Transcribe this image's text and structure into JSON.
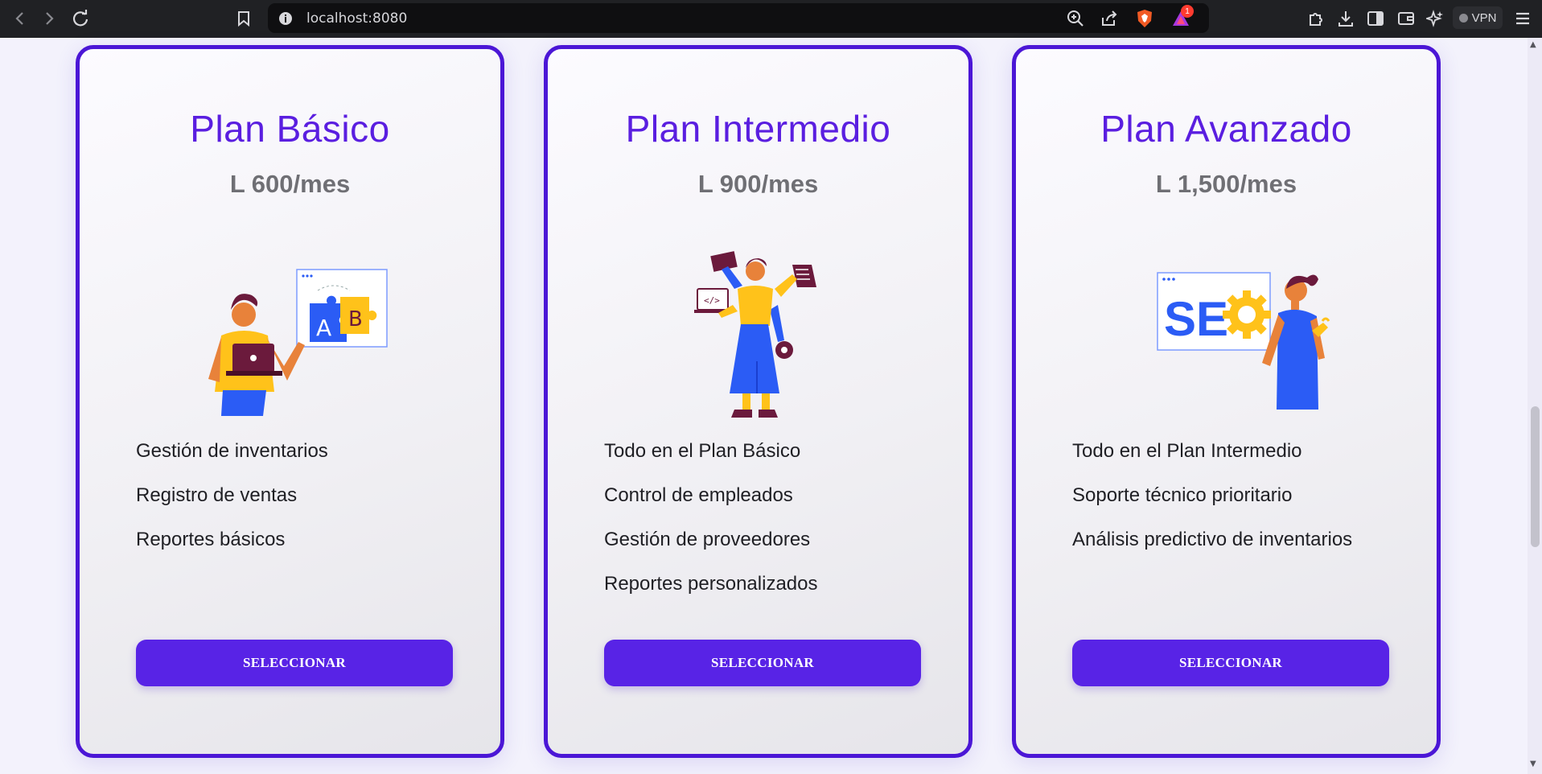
{
  "browser": {
    "url": "localhost:8080",
    "vpn_label": "VPN",
    "notification_count": "1"
  },
  "plans": [
    {
      "title": "Plan Básico",
      "price": "L 600/mes",
      "illustration": "ab-testing-illustration",
      "features": [
        "Gestión de inventarios",
        "Registro de ventas",
        "Reportes básicos"
      ],
      "button_label": "SELECCIONAR"
    },
    {
      "title": "Plan Intermedio",
      "price": "L 900/mes",
      "illustration": "multitasking-woman-illustration",
      "features": [
        "Todo en el Plan Básico",
        "Control de empleados",
        "Gestión de proveedores",
        "Reportes personalizados"
      ],
      "button_label": "SELECCIONAR"
    },
    {
      "title": "Plan Avanzado",
      "price": "L 1,500/mes",
      "illustration": "seo-illustration",
      "features": [
        "Todo en el Plan Intermedio",
        "Soporte técnico prioritario",
        "Análisis predictivo de inventarios"
      ],
      "button_label": "SELECCIONAR"
    }
  ],
  "colors": {
    "accent": "#5823e6",
    "card_border": "#4b16d6",
    "title": "#5a1ee0",
    "price": "#6f6f74",
    "illus_blue": "#2b5cf5",
    "illus_yellow": "#ffc21a",
    "illus_maroon": "#6b1a3c",
    "illus_skin": "#e8823a"
  }
}
